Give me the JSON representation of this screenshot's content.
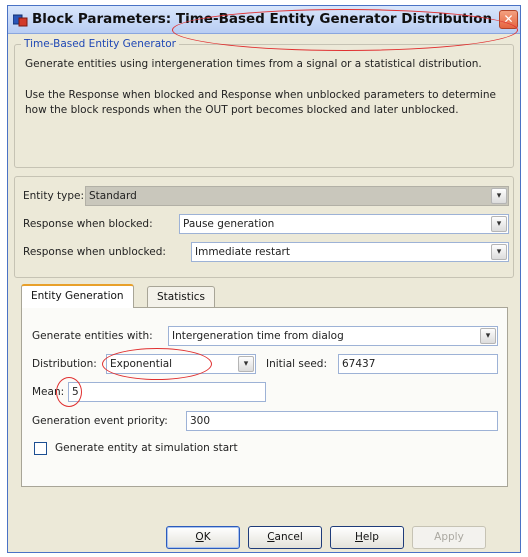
{
  "window": {
    "title": "Block Parameters: Time-Based Entity Generator Distribution ...",
    "close_glyph": "✕"
  },
  "description": {
    "group_title": "Time-Based Entity Generator",
    "line1": "Generate entities using intergeneration times from a signal or a statistical distribution.",
    "line2": "Use the Response when blocked and Response when unblocked parameters to determine how the block responds when the OUT port becomes blocked and later unblocked."
  },
  "params": {
    "entity_type_label": "Entity type:",
    "entity_type_value": "Standard",
    "response_blocked_label": "Response when blocked:",
    "response_blocked_value": "Pause generation",
    "response_unblocked_label": "Response when unblocked:",
    "response_unblocked_value": "Immediate restart"
  },
  "tabs": [
    {
      "label": "Entity Generation"
    },
    {
      "label": "Statistics"
    }
  ],
  "entity_generation": {
    "generate_with_label": "Generate entities with:",
    "generate_with_value": "Intergeneration time from dialog",
    "distribution_label": "Distribution:",
    "distribution_value": "Exponential",
    "initial_seed_label": "Initial seed:",
    "initial_seed_value": "67437",
    "mean_label": "Mean:",
    "mean_value": "5",
    "priority_label": "Generation event priority:",
    "priority_value": "300",
    "start_checkbox_label": "Generate entity at simulation start",
    "start_checkbox_checked": false
  },
  "buttons": {
    "ok_u": "O",
    "ok_rest": "K",
    "cancel_u": "C",
    "cancel_rest": "ancel",
    "help_u": "H",
    "help_rest": "elp",
    "apply": "Apply"
  },
  "dropdown_arrow_glyph": "▾",
  "colors": {
    "annotation": "#e03030",
    "group_title": "#1f48b5",
    "active_tab_accent": "#e8a02a"
  },
  "icons": {
    "window": "block-parameters-icon",
    "close": "close-icon",
    "dropdown": "chevron-down-icon"
  }
}
